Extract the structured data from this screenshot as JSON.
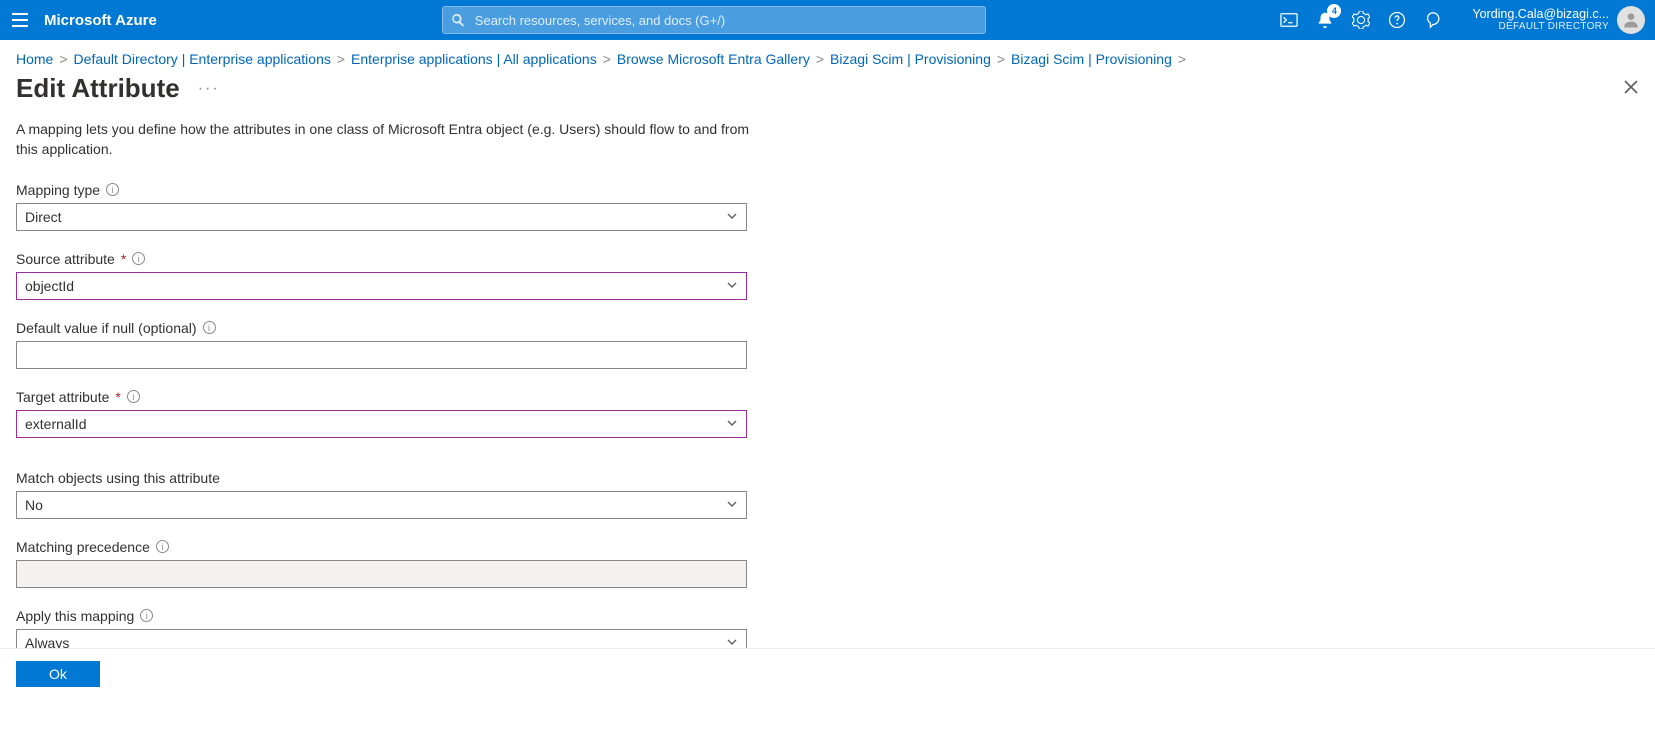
{
  "header": {
    "brand": "Microsoft Azure",
    "search_placeholder": "Search resources, services, and docs (G+/)",
    "notif_count": "4",
    "user_email": "Yording.Cala@bizagi.c...",
    "user_dir": "DEFAULT DIRECTORY"
  },
  "breadcrumbs": [
    "Home",
    "Default Directory | Enterprise applications",
    "Enterprise applications | All applications",
    "Browse Microsoft Entra Gallery",
    "Bizagi Scim | Provisioning",
    "Bizagi Scim | Provisioning"
  ],
  "page": {
    "title": "Edit Attribute",
    "description": "A mapping lets you define how the attributes in one class of Microsoft Entra object (e.g. Users) should flow to and from this application."
  },
  "form": {
    "mapping_type": {
      "label": "Mapping type",
      "value": "Direct"
    },
    "source_attr": {
      "label": "Source attribute",
      "value": "objectId"
    },
    "default_null": {
      "label": "Default value if null (optional)",
      "value": ""
    },
    "target_attr": {
      "label": "Target attribute",
      "value": "externalId"
    },
    "match_obj": {
      "label": "Match objects using this attribute",
      "value": "No"
    },
    "match_prec": {
      "label": "Matching precedence",
      "value": ""
    },
    "apply_map": {
      "label": "Apply this mapping",
      "value": "Always"
    }
  },
  "buttons": {
    "ok": "Ok"
  }
}
